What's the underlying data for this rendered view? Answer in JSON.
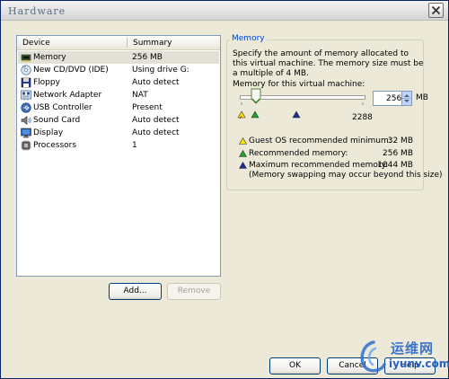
{
  "window": {
    "title": "Hardware"
  },
  "device_list": {
    "columns": [
      "Device",
      "Summary"
    ],
    "rows": [
      {
        "icon": "memory-chip-icon",
        "device": "Memory",
        "summary": "256 MB",
        "selected": true
      },
      {
        "icon": "cd-dvd-icon",
        "device": "New CD/DVD (IDE)",
        "summary": "Using drive G:",
        "selected": false
      },
      {
        "icon": "floppy-icon",
        "device": "Floppy",
        "summary": "Auto detect",
        "selected": false
      },
      {
        "icon": "network-adapter-icon",
        "device": "Network Adapter",
        "summary": "NAT",
        "selected": false
      },
      {
        "icon": "usb-icon",
        "device": "USB Controller",
        "summary": "Present",
        "selected": false
      },
      {
        "icon": "sound-card-icon",
        "device": "Sound Card",
        "summary": "Auto detect",
        "selected": false
      },
      {
        "icon": "display-icon",
        "device": "Display",
        "summary": "Auto detect",
        "selected": false
      },
      {
        "icon": "processor-icon",
        "device": "Processors",
        "summary": "1",
        "selected": false
      }
    ]
  },
  "buttons": {
    "add": "Add...",
    "remove": "Remove",
    "ok": "OK",
    "cancel": "Cancel",
    "help": "Help"
  },
  "memory": {
    "group_title": "Memory",
    "description": "Specify the amount of memory allocated to this virtual machine. The memory size must be a multiple of 4 MB.",
    "field_label": "Memory for this virtual machine:",
    "value": "256",
    "unit": "MB",
    "slider_max_label": "2288",
    "slider_value_mb": 256,
    "legend": [
      {
        "color": "#f5e600",
        "label": "Guest OS recommended minimum:",
        "value": "32 MB"
      },
      {
        "color": "#1fa32b",
        "label": "Recommended memory:",
        "value": "256 MB"
      },
      {
        "color": "#1b2b9c",
        "label": "Maximum recommended memory:",
        "value": "1044 MB"
      }
    ],
    "note": "(Memory swapping may occur beyond this size)"
  },
  "watermark": {
    "cn": "运维网",
    "en": "iyunv.com"
  }
}
